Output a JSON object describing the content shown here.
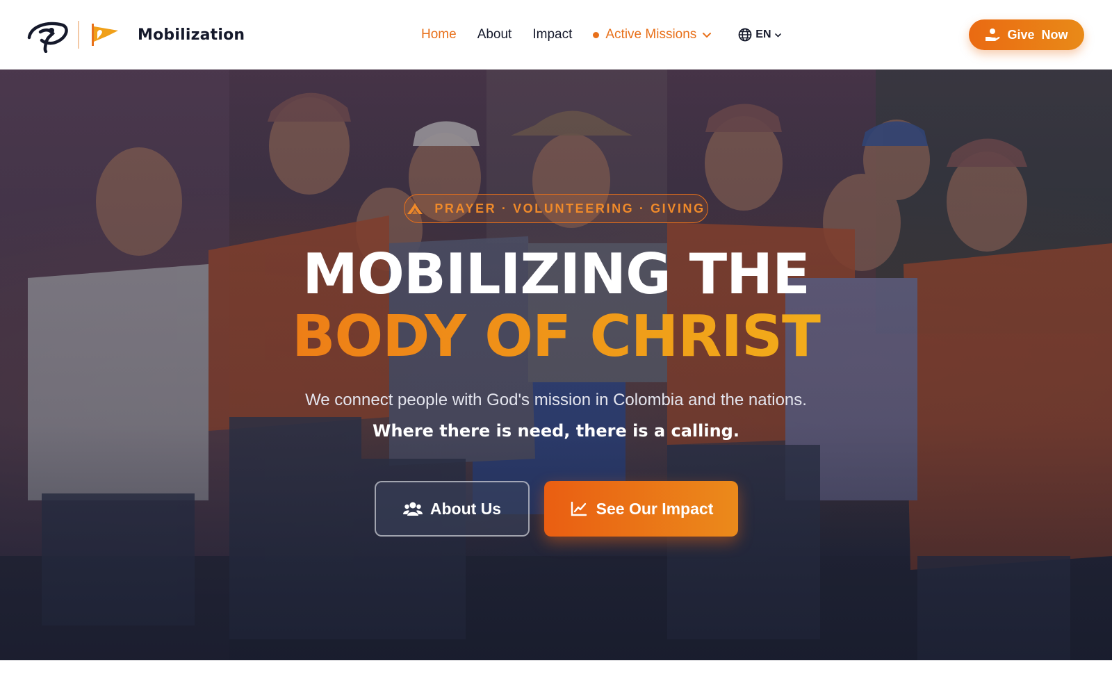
{
  "header": {
    "brand_name": "Mobilization",
    "nav": {
      "home": "Home",
      "about": "About",
      "impact": "Impact",
      "missions": "Active Missions",
      "language": "EN"
    },
    "give_label": "Give  Now"
  },
  "hero": {
    "tagline": "PRAYER · VOLUNTEERING · GIVING",
    "title_line1": "MOBILIZING THE",
    "title_line2": "BODY OF CHRIST",
    "subtitle": "We connect people with God's mission in Colombia and the nations.",
    "subtitle_bold": "Where there is need, there is a calling.",
    "about_button": "About Us",
    "impact_button": "See Our Impact"
  },
  "icons": {
    "brand_logo": "dove-logo-icon",
    "brand_flag": "flag-icon",
    "missions_dot": "live-dot-icon",
    "missions_caret": "chevron-down-icon",
    "language": "globe-icon",
    "give": "hand-heart-icon",
    "tagline": "praying-hands-icon",
    "about": "users-icon",
    "impact": "chart-line-icon"
  },
  "colors": {
    "accent": "#e8701a",
    "accent_light": "#f7c51f",
    "heading": "#15192b",
    "hero_text": "#ffffff"
  }
}
